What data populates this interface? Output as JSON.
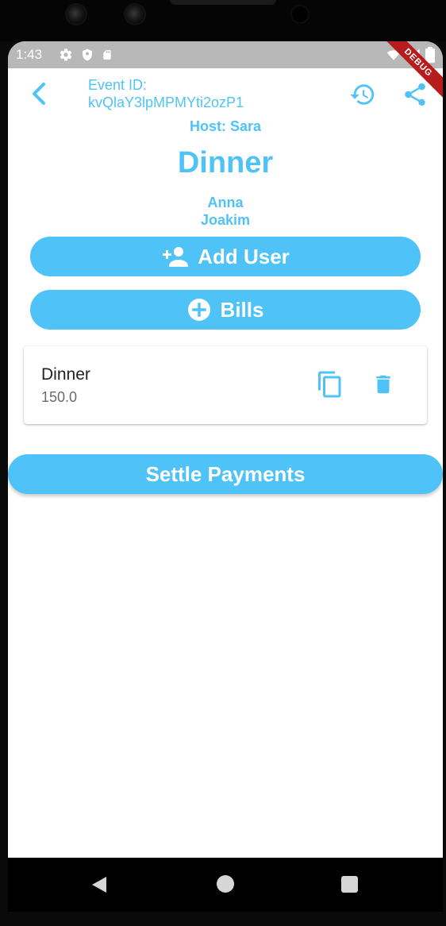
{
  "status_bar": {
    "time": "1:43",
    "icons_left": [
      "gear-icon",
      "shield-icon",
      "sd-card-icon"
    ],
    "icons_right": [
      "wifi-icon",
      "signal-icon",
      "battery-icon"
    ],
    "debug_banner": "DEBUG"
  },
  "header": {
    "event_id_label": "Event ID:",
    "event_id_value": "kvQlaY3lpMPMYti2ozP1",
    "back_icon": "chevron-left-icon",
    "history_icon": "history-icon",
    "share_icon": "share-icon"
  },
  "event": {
    "host_line": "Host: Sara",
    "title": "Dinner",
    "members": [
      "Anna",
      "Joakim"
    ]
  },
  "buttons": {
    "add_user": "Add User",
    "bills": "Bills",
    "settle": "Settle Payments"
  },
  "bills": [
    {
      "name": "Dinner",
      "amount": "150.0"
    }
  ],
  "colors": {
    "accent": "#4fc3f7",
    "status_bar": "#b8b8b8",
    "debug_ribbon": "#b71c1c"
  }
}
